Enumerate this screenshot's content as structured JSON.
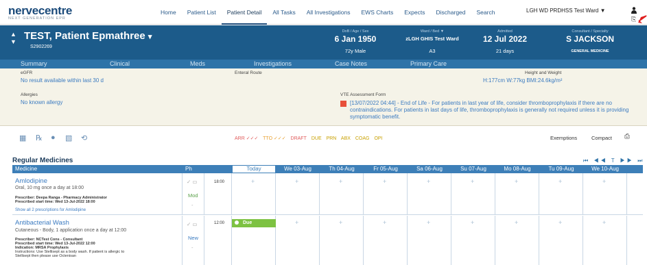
{
  "logo": {
    "main": "nervecentre",
    "sub": "NEXT GENERATION EPR"
  },
  "nav": {
    "links": [
      "Home",
      "Patient List",
      "Patient Detail",
      "All Tasks",
      "All Investigations",
      "EWS Charts",
      "Expects",
      "Discharged",
      "Search"
    ],
    "active": "Patient Detail",
    "ward": "LGH WD PRDHSS Test Ward ▼"
  },
  "patient": {
    "name": "TEST, Patient Epmathree",
    "name_arrow": "▾",
    "id": "S2902269",
    "dob_label": "DoB / Age / Sex",
    "dob": "6 Jan 1950",
    "age_sex": "72y Male",
    "ward_label": "Ward / Bed ▼",
    "ward": "zLGH GHIS Test Ward",
    "bed": "A3",
    "admitted_label": "Admitted",
    "admitted": "12 Jul 2022",
    "days": "21 days",
    "consultant_label": "Consultant / Specialty",
    "consultant": "S JACKSON",
    "specialty": "GENERAL MEDICINE"
  },
  "tabs": [
    "Summary",
    "Clinical",
    "Meds",
    "Investigations",
    "Case Notes",
    "Primary Care"
  ],
  "info": {
    "egfr_label": "eGFR",
    "egfr_value": "No result available within last 30 d",
    "enteral_label": "Enteral Route",
    "hw_label": "Height and Weight",
    "hw_value": "H:177cm  W:77kg  BMI:24.6kg/m²",
    "allergies_label": "Allergies",
    "allergies_value": "No known allergy",
    "vte_label": "VTE Assessment Form",
    "vte_text": "[13/07/2022 04:44] - End of Life - For patients in last year of life, consider thromboprophylaxis if there are no contraindications. For patients in last days of life, thromboprophylaxis is generally not required unless it is providing symptomatic benefit."
  },
  "toolbar": {
    "legend": [
      {
        "text": "ARR ✓✓✓",
        "color": "#e05a5a"
      },
      {
        "text": "TTO ✓✓✓",
        "color": "#e8a030"
      },
      {
        "text": "DRAFT",
        "color": "#e05a5a"
      },
      {
        "text": "DUE",
        "color": "#c8a000"
      },
      {
        "text": "PRN",
        "color": "#c8a000"
      },
      {
        "text": "ABX",
        "color": "#c8a000"
      },
      {
        "text": "COAG",
        "color": "#c8a000"
      },
      {
        "text": "OPI",
        "color": "#c8a000"
      }
    ],
    "exemptions": "Exemptions",
    "compact": "Compact",
    "print_icon": "⎙"
  },
  "section_title": "Regular Medicines",
  "pager": "⏮ ◀◀ T ▶▶ ⏭",
  "grid": {
    "headers": [
      "Medicine",
      "Ph",
      "Today",
      "We 03-Aug",
      "Th 04-Aug",
      "Fr 05-Aug",
      "Sa 06-Aug",
      "Su 07-Aug",
      "Mo 08-Aug",
      "Tu 09-Aug",
      "We 10-Aug"
    ]
  },
  "meds": [
    {
      "name": "Amlodipine",
      "desc": "Oral, 10 mg once a day at 18:00",
      "prescriber": "Prescriber: Deepa Ranga - Pharmacy Administrator",
      "start": "Prescribed start time: Wed 13-Jul-2022 18:00",
      "link": "Show all 2 prescriptions for Amlodipine",
      "ph_icons": "✓ ▭",
      "ph_status": "Mod",
      "ph_dash": "-",
      "time": "18:00"
    },
    {
      "name": "Antibacterial Wash",
      "desc": "Cutaneous - Body, 1 application once a day at 12:00",
      "prescriber": "Prescriber: NCTest Cons - Consultant",
      "start": "Prescribed start time: Wed 13-Jul-2022 12:00",
      "indication": "Indication: MRSA Prophylaxis",
      "instructions1": "Instructions: Use Stellisept as a body wash. If patient is allergic to",
      "instructions2": "Stellisept then please use Octenisan",
      "ph_icons": "✓ ▭",
      "ph_status": "New",
      "ph_dash": "-",
      "time": "12:00",
      "due_label": "Due"
    }
  ]
}
